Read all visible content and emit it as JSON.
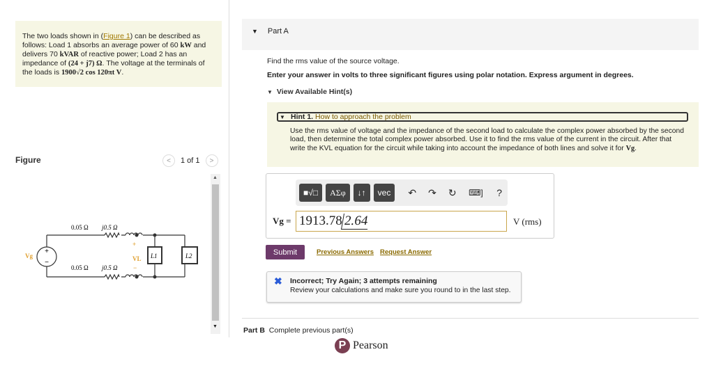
{
  "problem": {
    "p1": "The two loads shown in (",
    "link": "Figure 1",
    "p2": ") can be described as follows: Load 1 absorbs an average power of 60 ",
    "kw": "kW",
    "p3": " and delivers 70 ",
    "kvar": "kVAR",
    "p4": " of reactive power; Load 2 has an impedance of ",
    "z": "(24 + j7)  Ω",
    "p5": ". The voltage at the terminals of the loads is ",
    "v": "1900√2 cos 120πt V",
    "p6": "."
  },
  "figure": {
    "label": "Figure",
    "pager": "1 of 1",
    "prev": "<",
    "next": ">",
    "r1": "0.05 Ω",
    "x1": "j0.5 Ω",
    "r2": "0.05 Ω",
    "x2": "j0.5 Ω",
    "vg": "Vg",
    "vl": "VL",
    "l1": "L1",
    "l2": "L2",
    "plus": "+",
    "minus": "−"
  },
  "partA": {
    "title": "Part A",
    "q1": "Find the rms value of the source voltage.",
    "q2": "Enter your answer in volts to three significant figures using polar notation. Express argument in degrees.",
    "hints": "View Available Hint(s)",
    "hint": {
      "num": "Hint 1.",
      "title": "How to approach the problem",
      "body": "Use the rms value of voltage and the impedance of the second load to calculate the complex power absorbed by the second load, then determine the total complex power absorbed. Use it to find the rms value of the current in the circuit. After that write the KVL equation for the circuit while taking into account the impedance of both lines and solve it for ",
      "bodyVar": "Vg",
      "end": "."
    },
    "toolbar": {
      "templates": "■√□",
      "greek": "ΑΣφ",
      "arrows": "↓↑",
      "vec": "vec",
      "undo": "↶",
      "redo": "↷",
      "reset": "↻",
      "keyboard": "⌨]",
      "help": "?"
    },
    "answer": {
      "label": "Vg =",
      "magnitude": "1913.78",
      "angle": "2.64",
      "unit": "V (rms)"
    },
    "submit": "Submit",
    "prev_answers": "Previous Answers",
    "request": "Request Answer",
    "feedback": {
      "icon": "✖",
      "title": "Incorrect; Try Again; 3 attempts remaining",
      "body": "Review your calculations and make sure you round to in the last step."
    }
  },
  "partB": {
    "label": "Part B",
    "text": "Complete previous part(s)"
  },
  "brand": {
    "logo": "P",
    "name": "Pearson"
  },
  "colors": {
    "accent": "#6d3a6a",
    "link": "#8a6a00",
    "panel": "#f6f6e4"
  }
}
